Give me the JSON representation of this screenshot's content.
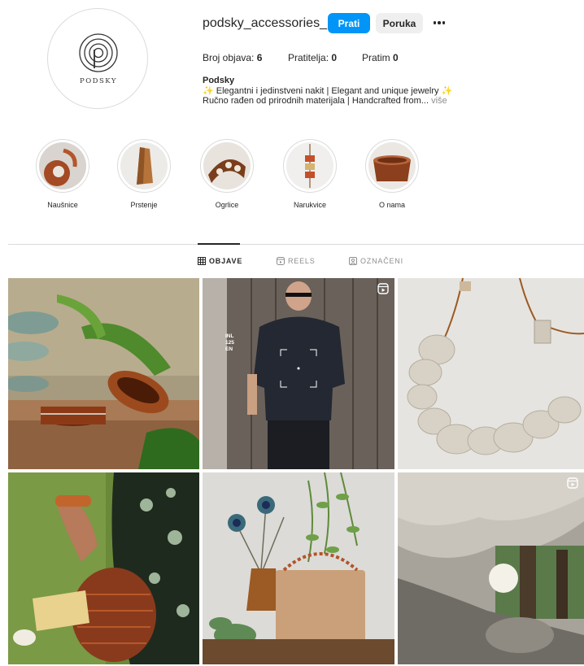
{
  "profile": {
    "username": "podsky_accessories_",
    "avatar_brand": "PODSKY",
    "follow_label": "Prati",
    "message_label": "Poruka",
    "more_icon": "more-horizontal-icon"
  },
  "stats": {
    "posts_label": "Broj objava:",
    "posts_value": "6",
    "followers_label": "Pratitelja:",
    "followers_value": "0",
    "following_label": "Pratim",
    "following_value": "0"
  },
  "bio": {
    "name": "Podsky",
    "line1_sparkle_left": "✨",
    "line1_text": " Elegantni i jedinstveni nakit | Elegant and unique jewelry ",
    "line1_sparkle_right": "✨",
    "line2_text": "Ručno rađen od prirodnih materijala | Handcrafted from... ",
    "more_label": "više"
  },
  "highlights": [
    {
      "label": "Naušnice"
    },
    {
      "label": "Prstenje"
    },
    {
      "label": "Ogrlice"
    },
    {
      "label": "Narukvice"
    },
    {
      "label": "O nama"
    }
  ],
  "tabs": [
    {
      "label": "OBJAVE",
      "icon": "grid-icon",
      "active": true
    },
    {
      "label": "REELS",
      "icon": "reels-icon",
      "active": false
    },
    {
      "label": "OZNAČENI",
      "icon": "tagged-icon",
      "active": false
    }
  ],
  "posts": [
    {
      "subject": "wooden rings",
      "is_reel": false
    },
    {
      "subject": "man in dark shirt",
      "is_reel": true
    },
    {
      "subject": "bone slice necklace",
      "is_reel": false
    },
    {
      "subject": "wooden bracelet and woven bag",
      "is_reel": false
    },
    {
      "subject": "peacock feathers and beaded handbag",
      "is_reel": false
    },
    {
      "subject": "rock overhang in forest",
      "is_reel": true
    }
  ],
  "post_overlay_text": [
    "INL",
    "125",
    "EN"
  ],
  "colors": {
    "accent": "#0095f6",
    "button_secondary": "#efefef",
    "text": "#262626",
    "muted": "#8e8e8e",
    "divider": "#dbdbdb"
  }
}
